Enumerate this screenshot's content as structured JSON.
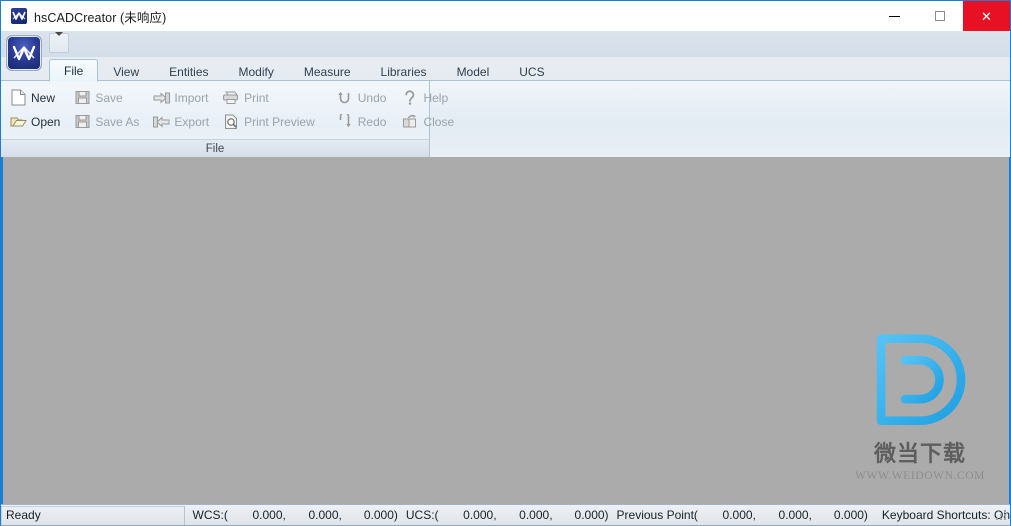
{
  "window": {
    "title": "hsCADCreator (未响应)",
    "app_icon": "cad-app-icon",
    "controls": {
      "minimize_label": "—",
      "maximize_label": "□",
      "close_label": "✕",
      "close_color": "#e81123"
    }
  },
  "quick_access": {
    "dropdown_name": "customize-quick-access-toolbar",
    "app_button_name": "application-menu-button"
  },
  "ribbon": {
    "tabs": [
      {
        "label": "File",
        "active": true
      },
      {
        "label": "View",
        "active": false
      },
      {
        "label": "Entities",
        "active": false
      },
      {
        "label": "Modify",
        "active": false
      },
      {
        "label": "Measure",
        "active": false
      },
      {
        "label": "Libraries",
        "active": false
      },
      {
        "label": "Model",
        "active": false
      },
      {
        "label": "UCS",
        "active": false
      }
    ],
    "group": {
      "title": "File",
      "columns": [
        {
          "items": [
            {
              "label": "New",
              "icon": "new-document-icon",
              "disabled": false
            },
            {
              "label": "Open",
              "icon": "open-folder-icon",
              "disabled": false
            }
          ]
        },
        {
          "items": [
            {
              "label": "Save",
              "icon": "save-floppy-icon",
              "disabled": true
            },
            {
              "label": "Save As",
              "icon": "save-as-floppy-icon",
              "disabled": true
            }
          ]
        },
        {
          "items": [
            {
              "label": "Import",
              "icon": "import-arrow-icon",
              "disabled": true
            },
            {
              "label": "Export",
              "icon": "export-arrow-icon",
              "disabled": true
            }
          ]
        },
        {
          "items": [
            {
              "label": "Print",
              "icon": "printer-icon",
              "disabled": true
            },
            {
              "label": "Print Preview",
              "icon": "print-preview-icon",
              "disabled": true
            }
          ]
        },
        {
          "items": [
            {
              "label": "Undo",
              "icon": "undo-arrow-icon",
              "disabled": true
            },
            {
              "label": "Redo",
              "icon": "redo-arrow-icon",
              "disabled": true
            }
          ]
        },
        {
          "items": [
            {
              "label": "Help",
              "icon": "help-question-icon",
              "disabled": true
            },
            {
              "label": "Close",
              "icon": "close-document-icon",
              "disabled": true
            }
          ]
        }
      ]
    }
  },
  "canvas": {
    "background_color": "#ababab",
    "watermark": {
      "logo_name": "weidown-d-logo",
      "logo_color": "#3fb4ef",
      "chinese_text": "微当下载",
      "url_text": "WWW.WEIDOWN.COM"
    }
  },
  "status_bar": {
    "ready_text": "Ready",
    "wcs": {
      "label": "WCS:(",
      "x": "0.000,",
      "y": "0.000,",
      "z": "0.000)"
    },
    "ucs": {
      "label": "UCS:(",
      "x": "0.000,",
      "y": "0.000,",
      "z": "0.000)"
    },
    "previous_point": {
      "label": "Previous Point(",
      "x": "0.000,",
      "y": "0.000,",
      "z": "0.000)"
    },
    "keyboard_shortcuts": "Keyboard Shortcuts: On"
  }
}
